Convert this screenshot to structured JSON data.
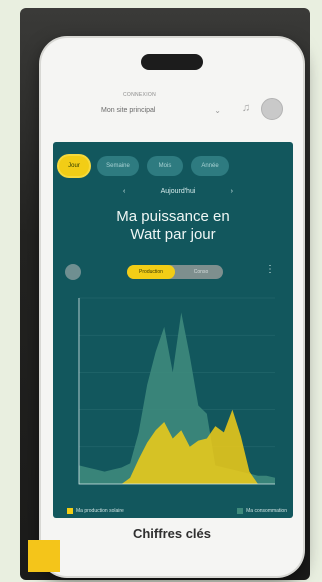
{
  "appbar": {
    "brand": "CONNEXION",
    "site_select": "Mon site principal"
  },
  "tabs": [
    "Jour",
    "Semaine",
    "Mois",
    "Année"
  ],
  "date": "Aujourd'hui",
  "title_line1": "Ma puissance en",
  "title_line2": "Watt par jour",
  "toggle": {
    "active": "Production",
    "inactive": "Conso"
  },
  "legend": {
    "production": "Ma production solaire",
    "consumption": "Ma consommation"
  },
  "bottom_title": "Chiffres clés",
  "colors": {
    "panel": "#12575d",
    "accent": "#f2cd16",
    "consumption": "#3e8a7c"
  },
  "chart_data": {
    "type": "area",
    "x": [
      0,
      1,
      2,
      3,
      4,
      5,
      6,
      7,
      8,
      9,
      10,
      11,
      12,
      13,
      14,
      15,
      16,
      17,
      18,
      19,
      20,
      21,
      22,
      23
    ],
    "series": [
      {
        "name": "Ma production solaire",
        "color": "#f2cd16",
        "values": [
          0,
          0,
          0,
          0,
          0,
          0,
          300,
          1200,
          2000,
          2600,
          3000,
          2200,
          2600,
          1800,
          2100,
          2200,
          2800,
          2500,
          3600,
          2300,
          600,
          0,
          0,
          0
        ]
      },
      {
        "name": "Ma consommation",
        "color": "#3e8a7c",
        "values": [
          900,
          800,
          700,
          600,
          700,
          800,
          1000,
          2500,
          4800,
          6400,
          7600,
          5400,
          8300,
          6200,
          3800,
          3400,
          900,
          800,
          700,
          600,
          500,
          400,
          400,
          300
        ]
      }
    ],
    "ylim": [
      0,
      9000
    ]
  }
}
